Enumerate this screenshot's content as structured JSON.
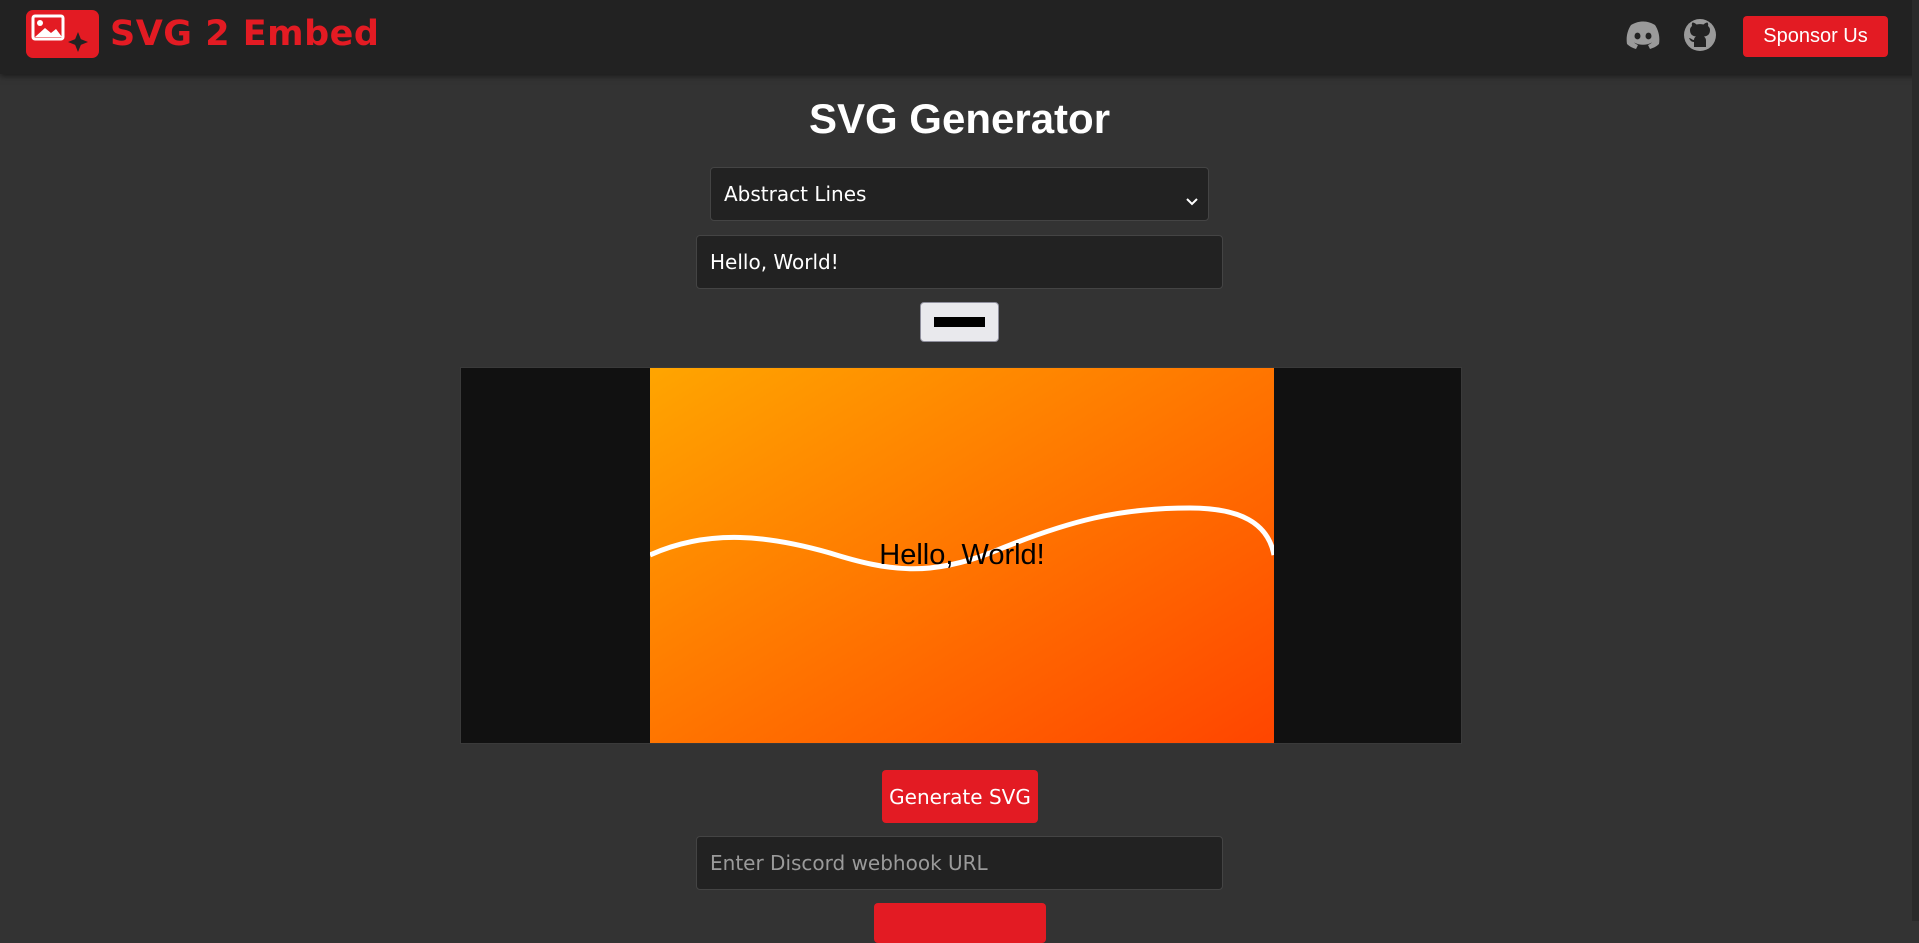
{
  "navbar": {
    "brand": "SVG 2 Embed",
    "logo_icon": "image-with-sparkle-icon",
    "discord_icon": "discord-icon",
    "github_icon": "github-icon",
    "sponsor_label": "Sponsor Us"
  },
  "main": {
    "title": "SVG Generator",
    "template_select": {
      "selected": "Abstract Lines",
      "icon": "chevron-down-icon"
    },
    "text_input": {
      "value": "Hello, World!"
    },
    "text_color": "#000000",
    "preview": {
      "text": "Hello, World!",
      "gradient_start": "#ffa500",
      "gradient_end": "#ff4500",
      "line_color": "#ffffff"
    },
    "generate_label": "Generate SVG",
    "webhook_input": {
      "placeholder": "Enter Discord webhook URL",
      "value": ""
    }
  },
  "colors": {
    "accent": "#e31b23",
    "background": "#333333",
    "navbar": "#222222"
  }
}
